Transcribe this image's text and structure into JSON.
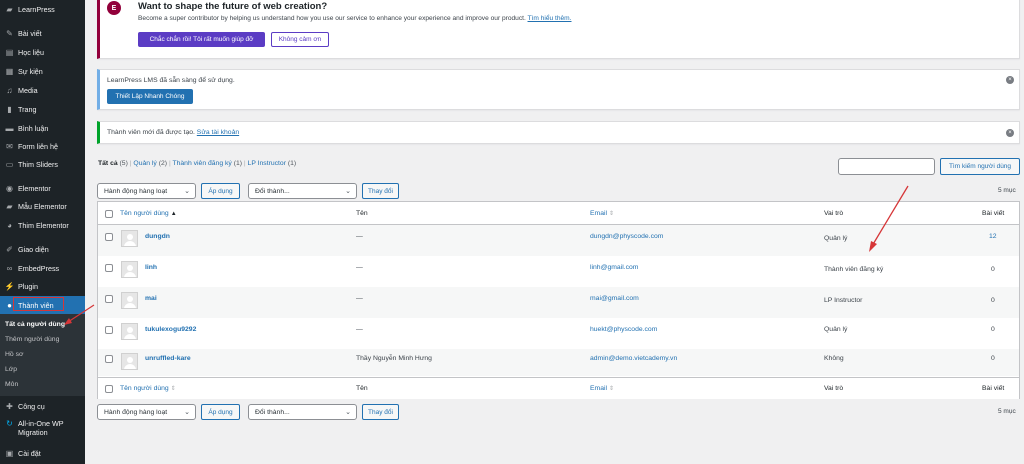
{
  "sidebar": {
    "items": [
      {
        "label": "LearnPress",
        "icon": "learnpress-icon"
      },
      {
        "label": "Bài viết",
        "icon": "pin-icon"
      },
      {
        "label": "Học liệu",
        "icon": "document-icon"
      },
      {
        "label": "Sự kiện",
        "icon": "calendar-icon"
      },
      {
        "label": "Media",
        "icon": "media-icon"
      },
      {
        "label": "Trang",
        "icon": "page-icon"
      },
      {
        "label": "Bình luận",
        "icon": "comment-icon"
      },
      {
        "label": "Form liên hệ",
        "icon": "mail-icon"
      },
      {
        "label": "Thim Sliders",
        "icon": "slides-icon"
      },
      {
        "label": "Elementor",
        "icon": "elementor-icon"
      },
      {
        "label": "Mẫu Elementor",
        "icon": "folder-icon"
      },
      {
        "label": "Thim Elementor",
        "icon": "elementor-alt-icon"
      },
      {
        "label": "Giao diện",
        "icon": "brush-icon"
      },
      {
        "label": "EmbedPress",
        "icon": "embed-icon"
      },
      {
        "label": "Plugin",
        "icon": "plugin-icon"
      },
      {
        "label": "Thành viên",
        "icon": "user-icon"
      },
      {
        "label": "Công cụ",
        "icon": "wrench-icon"
      },
      {
        "label": "All-in-One WP",
        "label2": "Migration",
        "icon": "migration-icon"
      },
      {
        "label": "Cài đặt",
        "icon": "settings-icon"
      }
    ],
    "submenu": [
      "Tất cả người dùng",
      "Thêm người dùng",
      "Hồ sơ",
      "Lớp",
      "Môn"
    ]
  },
  "elementor_notice": {
    "title": "Want to shape the future of web creation?",
    "text": "Become a super contributor by helping us understand how you use our service to enhance your experience and improve our product.",
    "link": "Tìm hiểu thêm.",
    "btn_yes": "Chắc chắn rồi! Tôi rất muốn giúp đỡ",
    "btn_no": "Không cảm ơn"
  },
  "learnpress_notice": {
    "text": "LearnPress LMS đã sẵn sàng để sử dụng.",
    "button": "Thiết Lập Nhanh Chóng"
  },
  "success_notice": {
    "text": "Thành viên mới đã được tạo.",
    "link": "Sửa tài khoản"
  },
  "filters": {
    "all": "Tất cả",
    "all_count": "(5)",
    "admin": "Quản lý",
    "admin_count": "(2)",
    "subscriber": "Thành viên đăng ký",
    "subscriber_count": "(1)",
    "instructor": "LP Instructor",
    "instructor_count": "(1)",
    "sep": "|"
  },
  "search": {
    "button": "Tìm kiếm người dùng",
    "value": ""
  },
  "bulk": {
    "action": "Hành động hàng loạt",
    "apply": "Áp dụng",
    "change_to": "Đổi thành...",
    "change": "Thay đổi",
    "count": "5 mục"
  },
  "table": {
    "headers": {
      "username": "Tên người dùng",
      "name": "Tên",
      "email": "Email",
      "role": "Vai trò",
      "posts": "Bài viết"
    },
    "rows": [
      {
        "username": "dungdn",
        "name": "—",
        "email": "dungdn@physcode.com",
        "role": "Quản lý",
        "posts": "12"
      },
      {
        "username": "linh",
        "name": "—",
        "email": "linh@gmail.com",
        "role": "Thành viên đăng ký",
        "posts": "0"
      },
      {
        "username": "mai",
        "name": "—",
        "email": "mai@gmail.com",
        "role": "LP Instructor",
        "posts": "0"
      },
      {
        "username": "tukulexogu9292",
        "name": "—",
        "email": "huekt@physcode.com",
        "role": "Quản lý",
        "posts": "0"
      },
      {
        "username": "unruffled-kare",
        "name": "Thầy Nguyễn Minh Hưng",
        "email": "admin@demo.vietcademy.vn",
        "role": "Không",
        "posts": "0"
      }
    ]
  },
  "colors": {
    "sidebar_bg": "#1d2327",
    "accent": "#2271b1",
    "elementor": "#92003b",
    "success": "#00a32a",
    "annotation": "#d63638"
  }
}
